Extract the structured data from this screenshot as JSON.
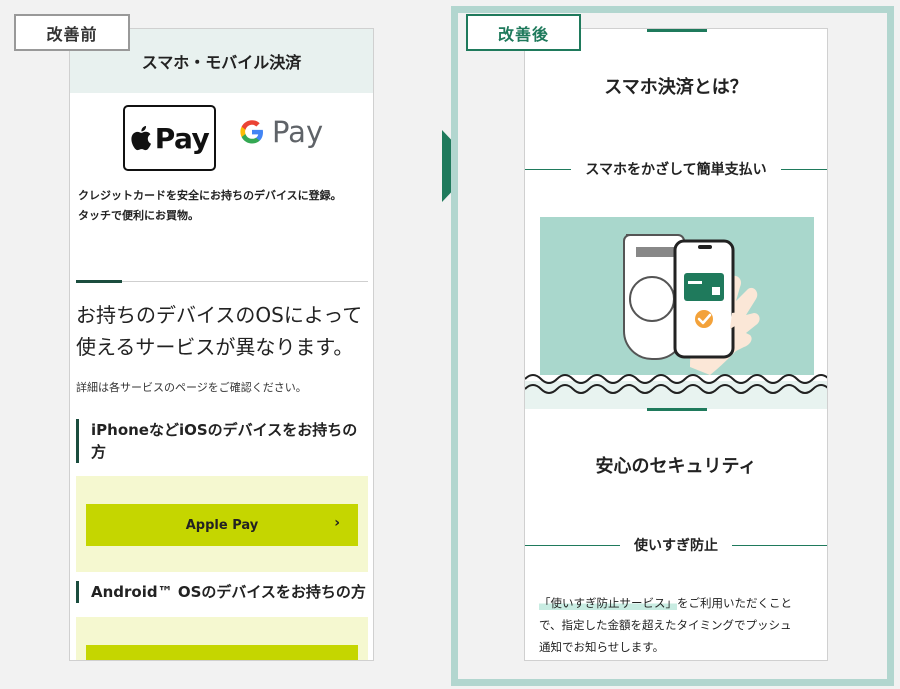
{
  "before": {
    "badge": "改善前",
    "header_title": "スマホ・モバイル決済",
    "apple_pay_text": "Pay",
    "google_pay_g": "G",
    "google_pay_text": "Pay",
    "description_line1": "クレジットカードを安全にお持ちのデバイスに登録。",
    "description_line2": "タッチで便利にお買物。",
    "heading_line1": "お持ちのデバイスのOSによって",
    "heading_line2": "使えるサービスが異なります。",
    "note": "詳細は各サービスのページをご確認ください。",
    "iphone_heading_line1": "iPhoneなどiOSのデバイスをお持ちの",
    "iphone_heading_line2": "方",
    "apple_pay_button": "Apple Pay",
    "apple_pay_button_chevron": "›",
    "android_heading": "Android™ OSのデバイスをお持ちの方"
  },
  "after": {
    "badge": "改善後",
    "title": "スマホ決済とは？",
    "subtitle": "スマホをかざして簡単支払い",
    "security_title": "安心のセキュリティ",
    "overuse_label": "使いすぎ防止",
    "body_highlight": "「使いすぎ防止サービス」",
    "body_rest_line1": "をご利用いただくこと",
    "body_line2": "で、指定した金額を超えたタイミングでプッシュ",
    "body_line3": "通知でお知らせします。"
  },
  "colors": {
    "accent_green": "#1f7a5c",
    "dark_green": "#1b4d3e",
    "mint": "#a9d7cc",
    "lime": "#c5d600",
    "pale_yellow": "#f5f8d0"
  }
}
